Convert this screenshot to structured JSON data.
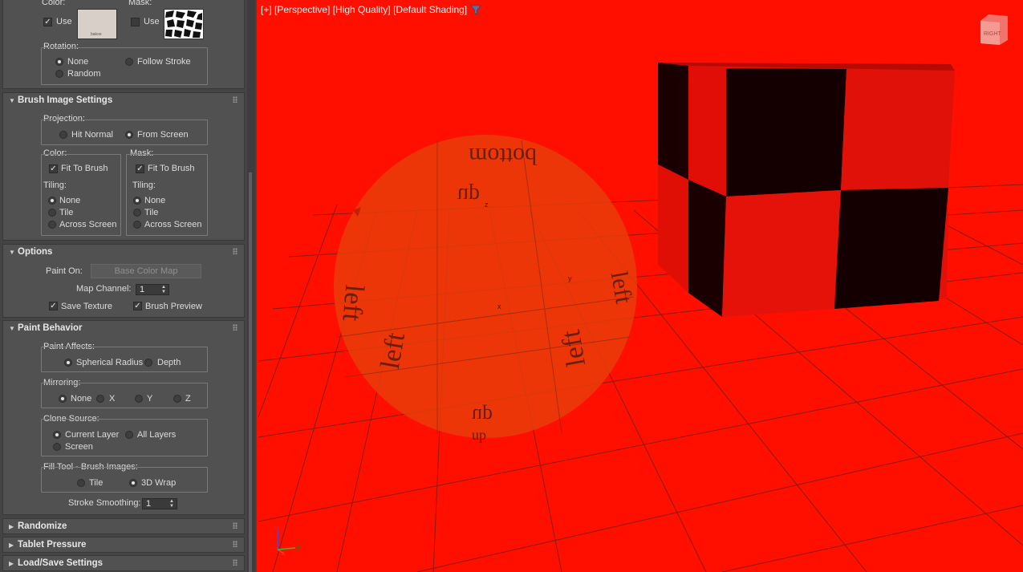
{
  "panel": {
    "top_section": {
      "color_label": "Color:",
      "mask_label": "Mask:",
      "color_use": "Use",
      "mask_use": "Use",
      "color_use_checked": true,
      "mask_use_checked": false,
      "thumb_color_text": "bakoe",
      "rotation_label": "Rotation:",
      "rotation_none": "None",
      "rotation_follow": "Follow Stroke",
      "rotation_random": "Random"
    },
    "brush_image_settings": {
      "title": "Brush Image Settings",
      "projection_label": "Projection:",
      "hit_normal": "Hit Normal",
      "from_screen": "From Screen",
      "color_label": "Color:",
      "mask_label": "Mask:",
      "fit_to_brush": "Fit To Brush",
      "tiling_label": "Tiling:",
      "none": "None",
      "tile": "Tile",
      "across_screen": "Across Screen"
    },
    "options": {
      "title": "Options",
      "paint_on_label": "Paint On:",
      "paint_on_value": "Base Color Map",
      "map_channel_label": "Map Channel:",
      "map_channel_value": "1",
      "save_texture": "Save Texture",
      "brush_preview": "Brush Preview"
    },
    "paint_behavior": {
      "title": "Paint Behavior",
      "paint_affects_label": "Paint Affects:",
      "spherical_radius": "Spherical Radius",
      "depth": "Depth",
      "mirroring_label": "Mirroring:",
      "mirror_none": "None",
      "mirror_x": "X",
      "mirror_y": "Y",
      "mirror_z": "Z",
      "clone_source_label": "Clone Source:",
      "current_layer": "Current Layer",
      "all_layers": "All Layers",
      "screen": "Screen",
      "fill_tool_label": "Fill Tool - Brush Images:",
      "fill_tile": "Tile",
      "fill_3d_wrap": "3D Wrap",
      "stroke_smoothing_label": "Stroke Smoothing:",
      "stroke_smoothing_value": "1"
    },
    "collapsed": {
      "randomize": "Randomize",
      "tablet_pressure": "Tablet Pressure",
      "load_save": "Load/Save Settings"
    }
  },
  "viewport": {
    "label": "[+] [Perspective] [High Quality] [Default Shading]",
    "background_color": "#ff0f00",
    "viewcube_text": "RIGHT",
    "sphere_texts": [
      "bottom",
      "up",
      "left",
      "left",
      "left",
      "left",
      "up",
      "up"
    ],
    "axis_letters": [
      "z",
      "y",
      "x"
    ],
    "gizmo_axes": [
      "z",
      "y",
      "x"
    ]
  },
  "colors": {
    "panel_bg": "#444444",
    "rollout_bg": "#515151",
    "viewport_red": "#ff0f00"
  }
}
